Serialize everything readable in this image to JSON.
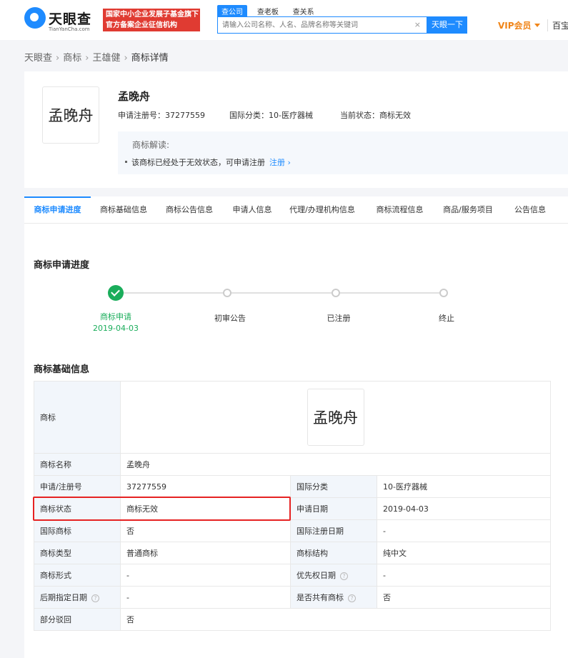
{
  "header": {
    "logo_name": "天眼查",
    "logo_sub": "TianYanCha.com",
    "badge_line1": "国家中小企业发展子基金旗下",
    "badge_line2": "官方备案企业征信机构",
    "search_tabs": [
      "查公司",
      "查老板",
      "查关系"
    ],
    "search_placeholder": "请输入公司名称、人名、品牌名称等关键词",
    "search_button": "天眼一下",
    "vip_label": "VIP会员",
    "right_text": "百宝"
  },
  "breadcrumb": [
    "天眼查",
    "商标",
    "王雄健",
    "商标详情"
  ],
  "trademark": {
    "image_text": "孟晚舟",
    "name": "孟晚舟",
    "reg_no_label": "申请注册号：",
    "reg_no": "37277559",
    "intl_class_label": "国际分类：",
    "intl_class": "10-医疗器械",
    "status_label": "当前状态：",
    "status": "商标无效",
    "interp_title": "商标解读:",
    "interp_text": "该商标已经处于无效状态，可申请注册",
    "interp_link": "注册 ›"
  },
  "tabs": [
    "商标申请进度",
    "商标基础信息",
    "商标公告信息",
    "申请人信息",
    "代理/办理机构信息",
    "商标流程信息",
    "商品/服务项目",
    "公告信息"
  ],
  "progress": {
    "title": "商标申请进度",
    "steps": [
      {
        "label": "商标申请",
        "date": "2019-04-03",
        "done": true
      },
      {
        "label": "初审公告",
        "date": "",
        "done": false
      },
      {
        "label": "已注册",
        "date": "",
        "done": false
      },
      {
        "label": "终止",
        "date": "",
        "done": false
      }
    ]
  },
  "basic_info": {
    "title": "商标基础信息",
    "trademark_label": "商标",
    "rows": [
      {
        "l1": "商标名称",
        "v1": "孟晚舟",
        "l2": "",
        "v2": ""
      },
      {
        "l1": "申请/注册号",
        "v1": "37277559",
        "l2": "国际分类",
        "v2": "10-医疗器械"
      },
      {
        "l1": "商标状态",
        "v1": "商标无效",
        "l2": "申请日期",
        "v2": "2019-04-03"
      },
      {
        "l1": "国际商标",
        "v1": "否",
        "l2": "国际注册日期",
        "v2": "-"
      },
      {
        "l1": "商标类型",
        "v1": "普通商标",
        "l2": "商标结构",
        "v2": "纯中文"
      },
      {
        "l1": "商标形式",
        "v1": "-",
        "l2": "优先权日期",
        "v2": "-"
      },
      {
        "l1": "后期指定日期",
        "v1": "-",
        "l2": "是否共有商标",
        "v2": "否"
      },
      {
        "l1": "部分驳回",
        "v1": "否",
        "l2": "",
        "v2": ""
      }
    ]
  },
  "colors": {
    "accent": "#1e8bff",
    "success": "#1aad5b",
    "highlight": "#e62222",
    "vip": "#f08519"
  }
}
